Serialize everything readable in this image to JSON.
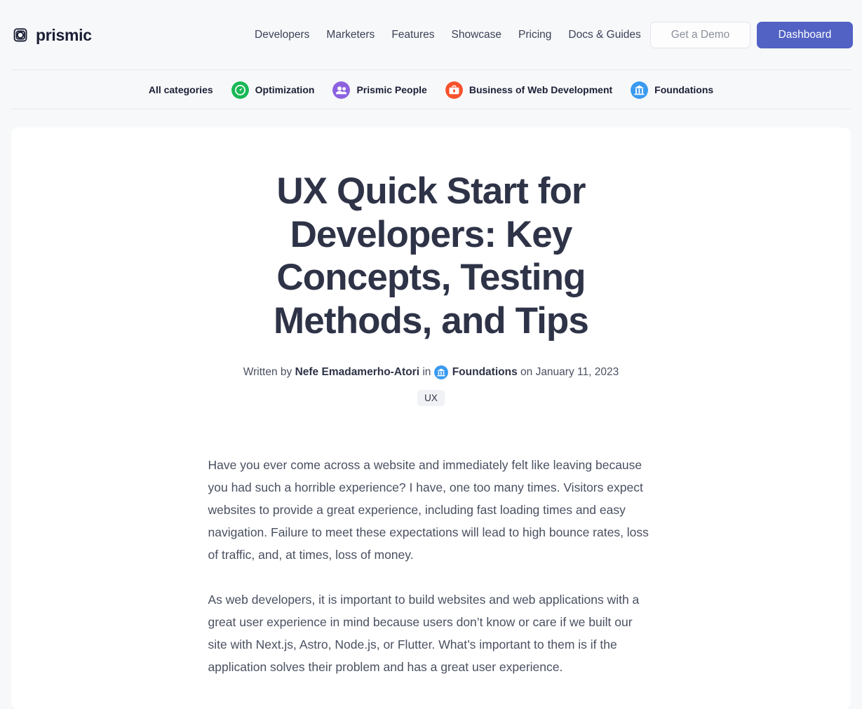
{
  "brand": {
    "name": "prismic",
    "logo_icon": "prismic-logo-icon"
  },
  "header": {
    "nav": [
      {
        "label": "Developers"
      },
      {
        "label": "Marketers"
      },
      {
        "label": "Features"
      },
      {
        "label": "Showcase"
      },
      {
        "label": "Pricing"
      },
      {
        "label": "Docs & Guides"
      }
    ],
    "demo_button": "Get a Demo",
    "dashboard_button": "Dashboard"
  },
  "categories": {
    "all_label": "All categories",
    "items": [
      {
        "label": "Optimization",
        "icon": "gauge-icon",
        "color": "#18b855"
      },
      {
        "label": "Prismic People",
        "icon": "people-icon",
        "color": "#8c62e0"
      },
      {
        "label": "Business of Web Development",
        "icon": "briefcase-icon",
        "color": "#f8522d"
      },
      {
        "label": "Foundations",
        "icon": "bank-icon",
        "color": "#3a9af0"
      }
    ]
  },
  "article": {
    "title": "UX Quick Start for Developers: Key Concepts, Testing Methods, and Tips",
    "byline": {
      "written_by_label": "Written by ",
      "author": "Nefe Emadamerho-Atori",
      "in_label": " in ",
      "category": "Foundations",
      "category_icon": "bank-icon",
      "category_color": "#3a9af0",
      "on_label": " on ",
      "date": "January 11, 2023"
    },
    "tags": [
      "UX"
    ],
    "paragraphs": [
      "Have you ever come across a website and immediately felt like leaving because you had such a horrible experience? I have, one too many times. Visitors expect websites to provide a great experience, including fast loading times and easy navigation. Failure to meet these expectations will lead to high bounce rates, loss of traffic, and, at times, loss of money.",
      "As web developers, it is important to build websites and web applications with a great user experience in mind because users don’t know or care if we built our site with Next.js, Astro, Node.js, or Flutter. What’s important to them is if the application solves their problem and has a great user experience."
    ]
  },
  "colors": {
    "page_background": "#f7f8fa",
    "card_background": "#ffffff",
    "accent": "#5161c4",
    "title_text": "#2e3347",
    "body_text": "#4a5061"
  }
}
